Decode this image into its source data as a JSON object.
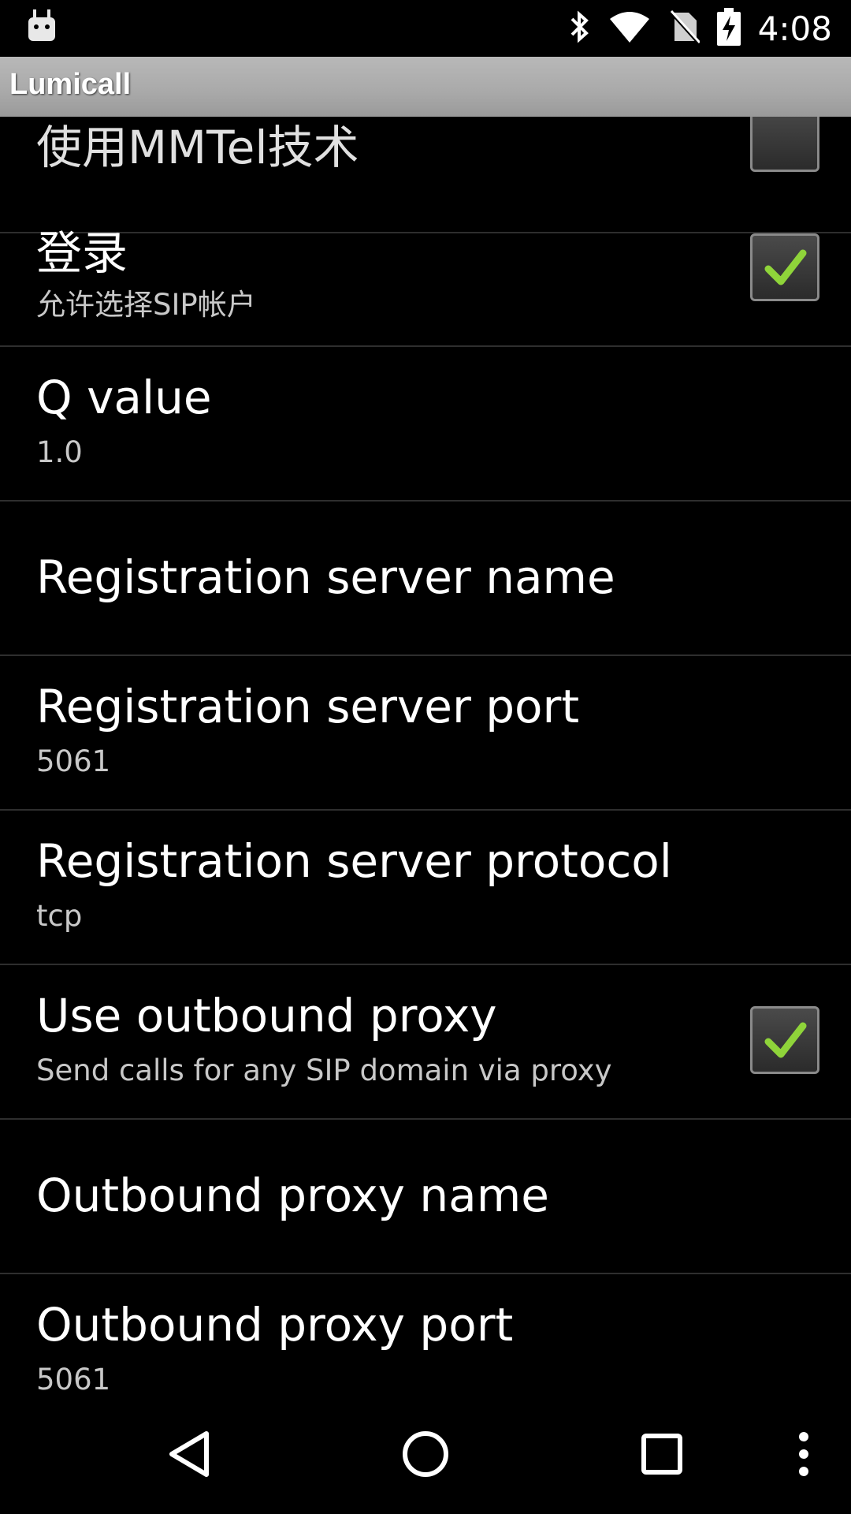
{
  "status_bar": {
    "time": "4:08",
    "icons": [
      "android-icon",
      "bluetooth-icon",
      "wifi-icon",
      "no-sim-icon",
      "battery-charging-icon"
    ]
  },
  "app": {
    "title": "Lumicall"
  },
  "settings": [
    {
      "title": "使用MMTel技术",
      "summary": "",
      "checkbox": true,
      "checked": false
    },
    {
      "title": "登录",
      "summary": "允许选择SIP帐户",
      "checkbox": true,
      "checked": true
    },
    {
      "title": "Q value",
      "summary": "1.0",
      "checkbox": false
    },
    {
      "title": "Registration server name",
      "summary": "",
      "checkbox": false
    },
    {
      "title": "Registration server port",
      "summary": "5061",
      "checkbox": false
    },
    {
      "title": "Registration server protocol",
      "summary": "tcp",
      "checkbox": false
    },
    {
      "title": "Use outbound proxy",
      "summary": "Send calls for any SIP domain via proxy",
      "checkbox": true,
      "checked": true
    },
    {
      "title": "Outbound proxy name",
      "summary": "",
      "checkbox": false
    },
    {
      "title": "Outbound proxy port",
      "summary": "5061",
      "checkbox": false
    }
  ],
  "nav": {
    "buttons": [
      "back-icon",
      "home-icon",
      "recents-icon",
      "overflow-menu-icon"
    ]
  },
  "colors": {
    "check": "#8fd43a",
    "action_bar": "#a9a9a9",
    "divider": "#2e2e2e"
  }
}
